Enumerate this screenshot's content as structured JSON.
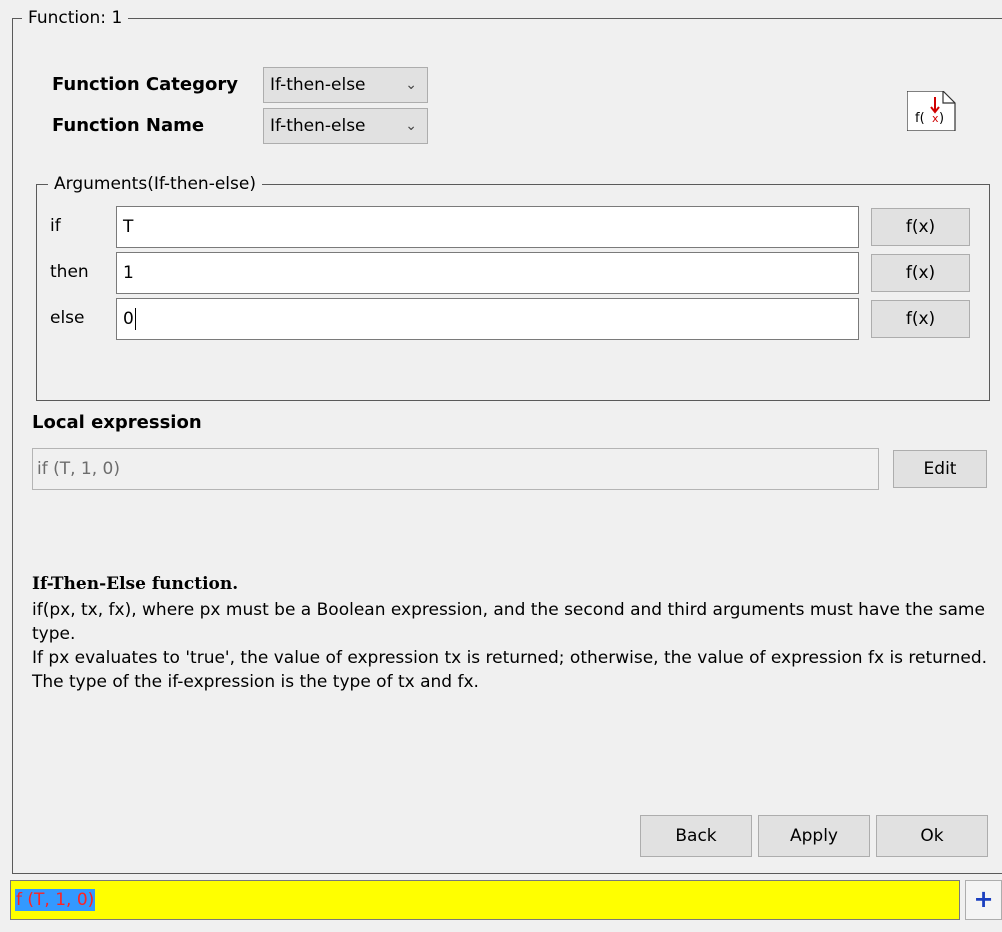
{
  "function_group": {
    "legend": "Function: 1"
  },
  "category": {
    "label": "Function Category",
    "value": "If-then-else"
  },
  "name": {
    "label": "Function Name",
    "value": "If-then-else"
  },
  "icon": {
    "name": "function-doc-icon",
    "text": "f(x)"
  },
  "arguments": {
    "legend": "Arguments(If-then-else)",
    "rows": [
      {
        "label": "if",
        "value": "T",
        "button": "f(x)"
      },
      {
        "label": "then",
        "value": "1",
        "button": "f(x)"
      },
      {
        "label": "else",
        "value": "0",
        "button": "f(x)"
      }
    ]
  },
  "local_expression": {
    "label": "Local expression",
    "value": "if (T, 1, 0)",
    "edit_button": "Edit"
  },
  "description": {
    "title": "If-Then-Else function.",
    "lines": [
      "if(px, tx, fx), where px must be a Boolean expression, and the second and third arguments must have the same type.",
      "If px evaluates to 'true', the value of expression tx is returned; otherwise, the value of expression fx is returned.",
      "The type of the if-expression is the type of tx and fx."
    ]
  },
  "footer_buttons": {
    "back": "Back",
    "apply": "Apply",
    "ok": "Ok"
  },
  "bottom_bar": {
    "expression": "f (T, 1, 0)",
    "add_button": "+",
    "background": "#ffff00"
  }
}
